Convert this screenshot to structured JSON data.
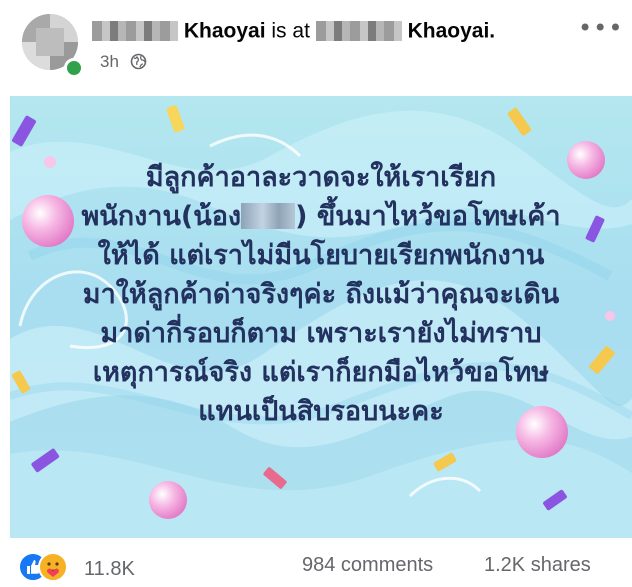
{
  "post": {
    "page_name_1": "Khaoyai",
    "middle_text": "is at",
    "page_name_2": "Khaoyai.",
    "time": "3h",
    "visibility_icon": "globe-icon",
    "more_icon": "more-options-icon"
  },
  "image_text": {
    "lines": [
      "มีลูกค้าอาละวาดจะให้เราเรียก",
      "พนักงาน(น้อง",
      ") ขึ้นมาไหว้ขอโทษเค้า",
      "ให้ได้ แต่เราไม่มีนโยบายเรียกพนักงาน",
      "มาให้ลูกค้าด่าจริงๆค่ะ ถึงแม้ว่าคุณจะเดิน",
      "มาด่ากี่รอบก็ตาม เพราะเรายังไม่ทราบ",
      "เหตุการณ์จริง แต่เราก็ยกมือไหว้ขอโทษ",
      "แทนเป็นสิบรอบนะคะ"
    ],
    "text_color": "#23315f",
    "background_color": "#aee0ef"
  },
  "stats": {
    "reaction_icons": [
      "like-icon",
      "care-icon"
    ],
    "reaction_count": "11.8K",
    "comments": "984 comments",
    "shares": "1.2K shares"
  }
}
